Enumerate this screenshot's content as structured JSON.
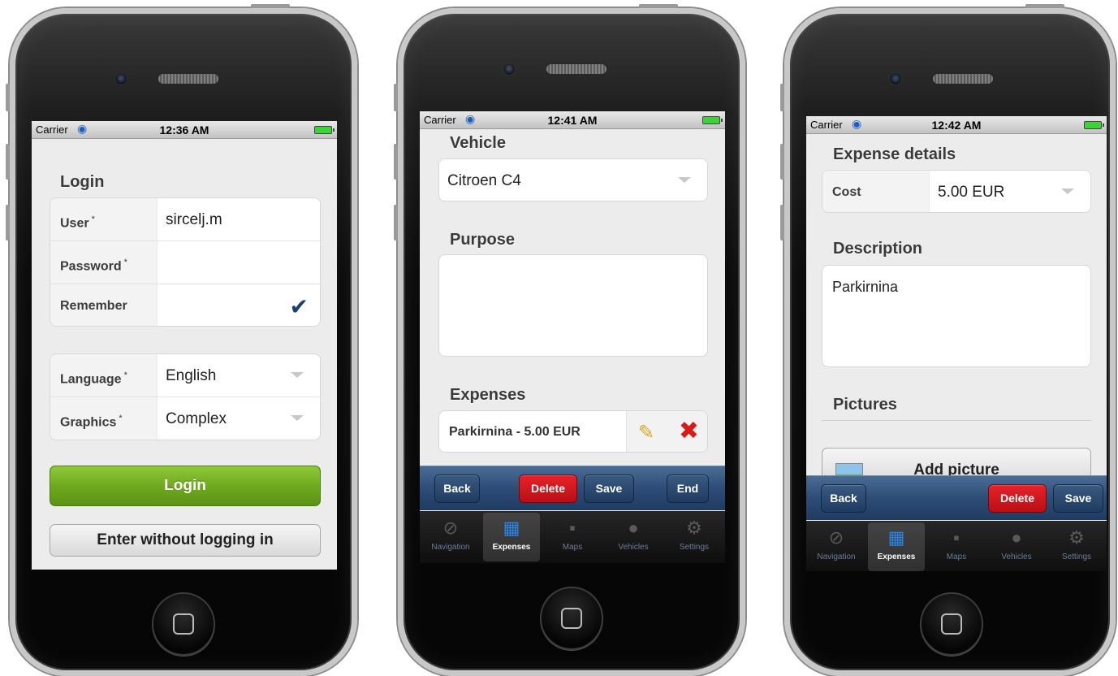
{
  "status_bar": {
    "carrier": "Carrier",
    "wifi_icon": "wifi-icon",
    "battery_icon": "battery-icon",
    "times": [
      "12:36 AM",
      "12:41 AM",
      "12:42 AM"
    ]
  },
  "screen1": {
    "section_title": "Login",
    "fields": [
      {
        "label": "User",
        "required": "*",
        "value": "sircelj.m"
      },
      {
        "label": "Password",
        "required": "*",
        "value": ""
      },
      {
        "label": "Remember",
        "required": "",
        "value": "",
        "checked": true
      }
    ],
    "settings": [
      {
        "label": "Language",
        "required": "*",
        "value": "English"
      },
      {
        "label": "Graphics",
        "required": "*",
        "value": "Complex"
      }
    ],
    "login_button": "Login",
    "guest_button": "Enter without logging in"
  },
  "screen2": {
    "vehicle_title": "Vehicle",
    "vehicle_value": "Citroen C4",
    "purpose_title": "Purpose",
    "purpose_value": "",
    "expenses_title": "Expenses",
    "expense_item": "Parkirnina - 5.00 EUR",
    "toolbar": {
      "back": "Back",
      "delete": "Delete",
      "save": "Save",
      "end": "End"
    }
  },
  "screen3": {
    "details_title": "Expense details",
    "cost_label": "Cost",
    "cost_value": "5.00 EUR",
    "description_title": "Description",
    "description_value": "Parkirnina",
    "pictures_title": "Pictures",
    "add_picture": "Add picture",
    "toolbar": {
      "back": "Back",
      "delete": "Delete",
      "save": "Save"
    }
  },
  "tab_bar": {
    "active": "Expenses",
    "tabs": [
      {
        "label": "Navigation",
        "icon": "compass-icon"
      },
      {
        "label": "Expenses",
        "icon": "document-icon"
      },
      {
        "label": "Maps",
        "icon": "map-icon"
      },
      {
        "label": "Vehicles",
        "icon": "car-icon"
      },
      {
        "label": "Settings",
        "icon": "gear-icon"
      }
    ]
  },
  "colors": {
    "accent_green": "#6fa91e",
    "toolbar_blue": "#2d4d78",
    "delete_red": "#d61b1b",
    "check_blue": "#1c3f74",
    "active_tab_blue": "#2a86e8"
  }
}
